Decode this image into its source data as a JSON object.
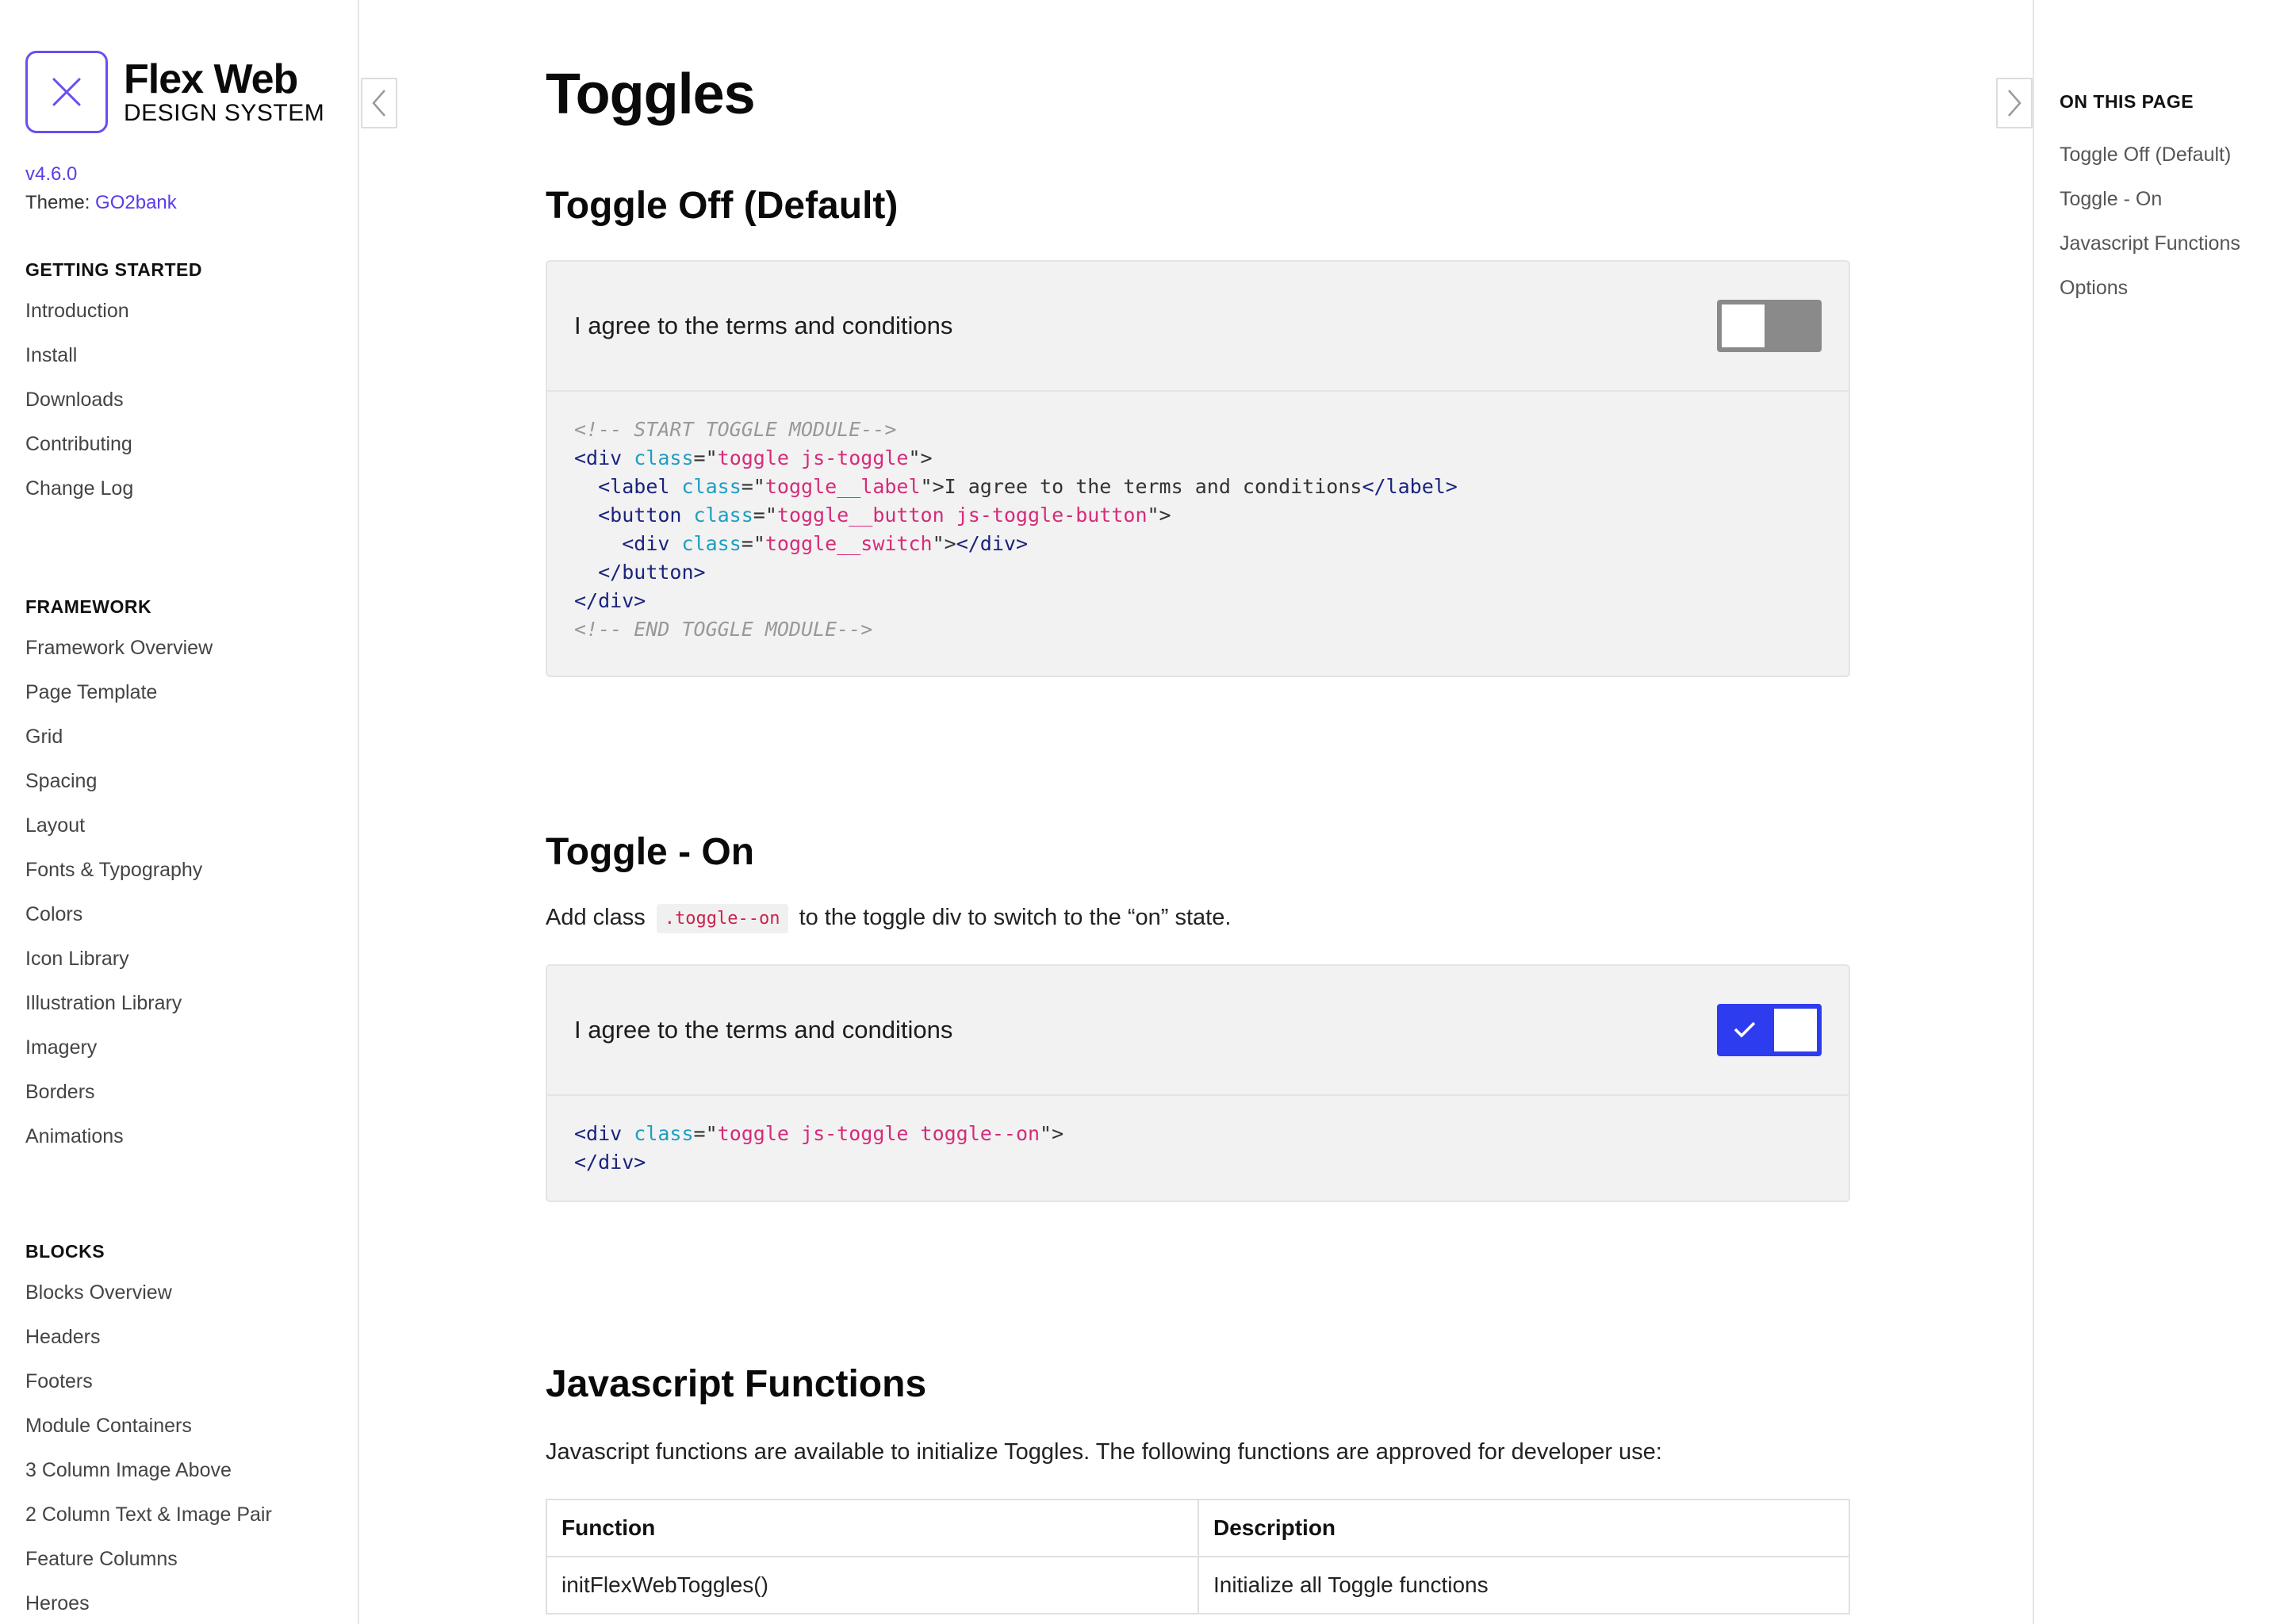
{
  "brand": {
    "title": "Flex Web",
    "subtitle": "DESIGN SYSTEM",
    "version": "v4.6.0",
    "theme_label": "Theme:",
    "theme_value": "GO2bank",
    "accent": "#5b3be8"
  },
  "sidebar": {
    "sections": [
      {
        "heading": "GETTING STARTED",
        "items": [
          "Introduction",
          "Install",
          "Downloads",
          "Contributing",
          "Change Log"
        ]
      },
      {
        "heading": "FRAMEWORK",
        "items": [
          "Framework Overview",
          "Page Template",
          "Grid",
          "Spacing",
          "Layout",
          "Fonts & Typography",
          "Colors",
          "Icon Library",
          "Illustration Library",
          "Imagery",
          "Borders",
          "Animations"
        ]
      },
      {
        "heading": "BLOCKS",
        "items": [
          "Blocks Overview",
          "Headers",
          "Footers",
          "Module Containers",
          "3 Column Image Above",
          "2 Column Text & Image Pair",
          "Feature Columns",
          "Heroes"
        ]
      }
    ]
  },
  "page": {
    "title": "Toggles",
    "sections": {
      "off": {
        "title": "Toggle Off (Default)",
        "demo_label": "I agree to the terms and conditions",
        "toggle_state": "off"
      },
      "on": {
        "title": "Toggle - On",
        "desc_before": "Add class",
        "desc_code": ".toggle--on",
        "desc_after": "to the toggle div to switch to the “on” state.",
        "demo_label": "I agree to the terms and conditions",
        "toggle_state": "on"
      },
      "js": {
        "title": "Javascript Functions",
        "desc": "Javascript functions are available to initialize Toggles. The following functions are approved for developer use:",
        "table": {
          "headers": [
            "Function",
            "Description"
          ],
          "rows": [
            [
              "initFlexWebToggles()",
              "Initialize all Toggle functions"
            ]
          ]
        }
      }
    }
  },
  "toc": {
    "heading": "ON THIS PAGE",
    "items": [
      "Toggle Off (Default)",
      "Toggle - On",
      "Javascript Functions",
      "Options"
    ]
  },
  "colors": {
    "toggle_off": "#8a8a8a",
    "toggle_on": "#2e3cf0"
  }
}
